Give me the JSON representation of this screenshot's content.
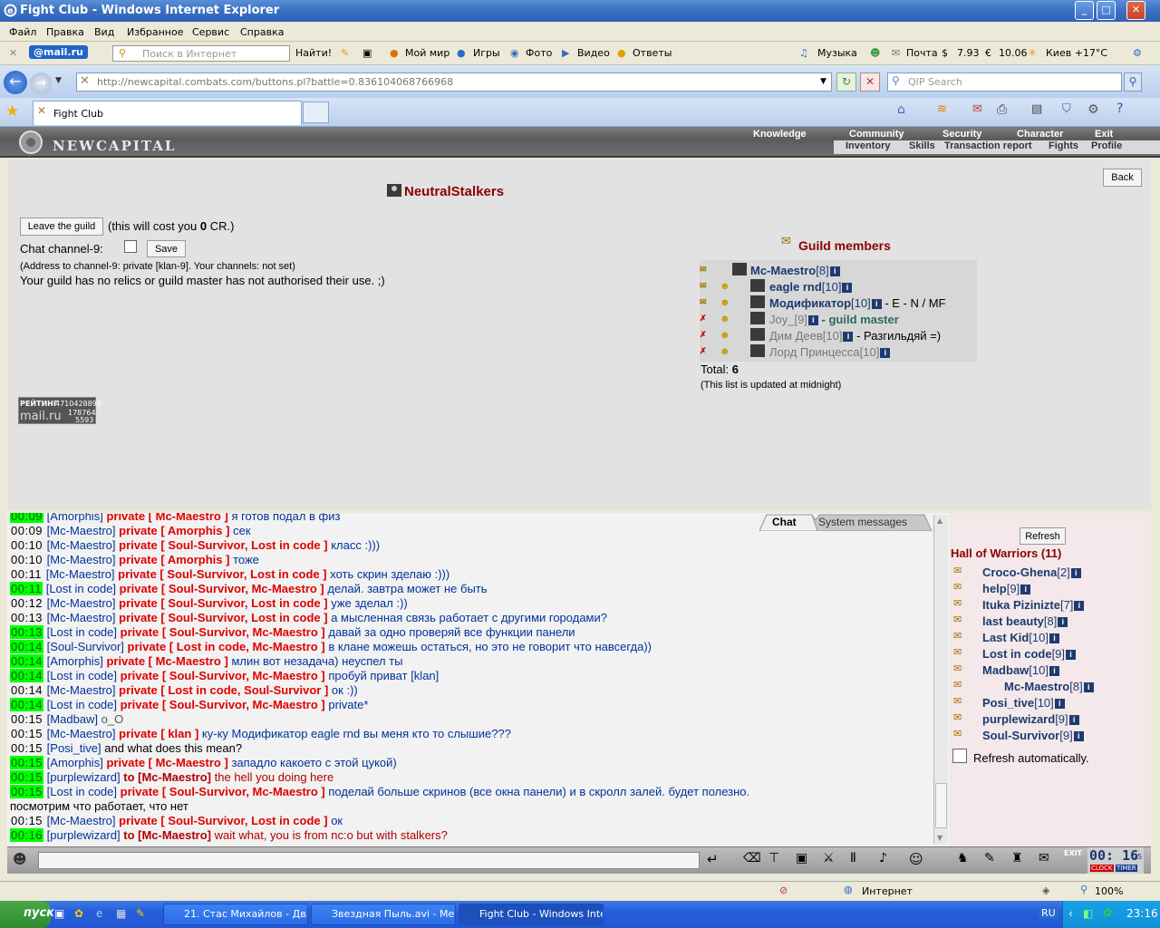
{
  "window": {
    "title": "Fight Club - Windows Internet Explorer"
  },
  "menu": [
    "Файл",
    "Правка",
    "Вид",
    "Избранное",
    "Сервис",
    "Справка"
  ],
  "toolbar": {
    "mailru": "@mail.ru",
    "search_placeholder": "Поиск в Интернет",
    "find": "Найти!",
    "links": [
      "Мой мир",
      "Игры",
      "Фото",
      "Видео",
      "Ответы"
    ],
    "music": "Музыка",
    "mail": "Почта",
    "usd": "7.93",
    "eur": "10.06",
    "weather": "Киев +17°C"
  },
  "address": {
    "url": "http://newcapital.combats.com/buttons.pl?battle=0.836104068766968",
    "qip": "QIP Search"
  },
  "tab": {
    "label": "Fight Club"
  },
  "site": {
    "logo": "NEWCAPITAL",
    "nav": [
      "Knowledge",
      "Community",
      "Security",
      "Character",
      "Exit"
    ],
    "subnav": [
      "Inventory",
      "Skills",
      "Transaction report",
      "Fights",
      "Profile"
    ]
  },
  "guild": {
    "name": "NeutralStalkers",
    "back": "Back",
    "leave": "Leave the guild",
    "cost_pre": "(this will cost you ",
    "cost_num": "0",
    "cost_post": " CR.)",
    "chat_label": "Chat channel-9:",
    "save": "Save",
    "address_note": "(Address to channel-9: private [klan-9]. Your channels: not set)",
    "relics": "Your guild has no relics or guild master has not authorised their use. ;)",
    "members_title": "Guild members",
    "total_label": "Total:",
    "total": "6",
    "update_note": "(This list is updated at midnight)",
    "badge": {
      "label": "РЕЙТИНГ",
      "num": "4710428892",
      "l2": "178764",
      "l3": "5593",
      "brand": "mail.ru"
    },
    "members": [
      {
        "name": "Mc-Maestro",
        "lvl": "[8]",
        "extra": "",
        "grey": false
      },
      {
        "name": "eagle rnd",
        "lvl": "[10]",
        "extra": "",
        "grey": false
      },
      {
        "name": "Модификатор",
        "lvl": "[10]",
        "extra": " - E - N / MF",
        "grey": false
      },
      {
        "name": "Joy_",
        "lvl": "[9]",
        "extra": " - guild master",
        "grey": true
      },
      {
        "name": "Дим Деев",
        "lvl": "[10]",
        "extra": " - Разгильдяй =)",
        "grey": true
      },
      {
        "name": "Лорд Принцесса",
        "lvl": "[10]",
        "extra": "",
        "grey": true
      }
    ]
  },
  "chat": {
    "tab_chat": "Chat",
    "tab_sys": "System messages",
    "lines": [
      {
        "t": "00:09",
        "g": true,
        "s": "Amorphis",
        "p": "private [ Mc-Maestro ]",
        "m": "я готов подал в физ",
        "pc": "pv"
      },
      {
        "t": "00:09",
        "g": false,
        "s": "Mc-Maestro",
        "p": "private [ Amorphis ]",
        "m": "сек",
        "pc": "pv"
      },
      {
        "t": "00:10",
        "g": false,
        "s": "Mc-Maestro",
        "p": "private [ Soul-Survivor, Lost in code ]",
        "m": "класс :)))",
        "pc": "pv"
      },
      {
        "t": "00:10",
        "g": false,
        "s": "Mc-Maestro",
        "p": "private [ Amorphis ]",
        "m": "тоже",
        "pc": "pv"
      },
      {
        "t": "00:11",
        "g": false,
        "s": "Mc-Maestro",
        "p": "private [ Soul-Survivor, Lost in code ]",
        "m": "хоть скрин зделаю :)))",
        "pc": "pv"
      },
      {
        "t": "00:11",
        "g": true,
        "s": "Lost in code",
        "p": "private [ Soul-Survivor, Mc-Maestro ]",
        "m": "делай. завтра может не быть",
        "pc": "pv"
      },
      {
        "t": "00:12",
        "g": false,
        "s": "Mc-Maestro",
        "p": "private [ Soul-Survivor, Lost in code ]",
        "m": "уже зделал :))",
        "pc": "pv"
      },
      {
        "t": "00:13",
        "g": false,
        "s": "Mc-Maestro",
        "p": "private [ Soul-Survivor, Lost in code ]",
        "m": "а мысленная связь работает с другими городами?",
        "pc": "pv"
      },
      {
        "t": "00:13",
        "g": true,
        "s": "Lost in code",
        "p": "private [ Soul-Survivor, Mc-Maestro ]",
        "m": "давай за одно проверяй все функции панели",
        "pc": "pv"
      },
      {
        "t": "00:14",
        "g": true,
        "s": "Soul-Survivor",
        "p": "private [ Lost in code, Mc-Maestro ]",
        "m": "в клане можешь остаться, но это не говорит что навсегда))",
        "pc": "pv"
      },
      {
        "t": "00:14",
        "g": true,
        "s": "Amorphis",
        "p": "private [ Mc-Maestro ]",
        "m": "млин вот незадача) неуспел ты",
        "pc": "pv"
      },
      {
        "t": "00:14",
        "g": true,
        "s": "Lost in code",
        "p": "private [ Soul-Survivor, Mc-Maestro ]",
        "m": "пробуй приват [klan]",
        "pc": "pv"
      },
      {
        "t": "00:14",
        "g": false,
        "s": "Mc-Maestro",
        "p": "private [ Lost in code, Soul-Survivor ]",
        "m": "ок :))",
        "pc": "pv"
      },
      {
        "t": "00:14",
        "g": true,
        "s": "Lost in code",
        "p": "private [ Soul-Survivor, Mc-Maestro ]",
        "m": "private*",
        "pc": "pv"
      },
      {
        "t": "00:15",
        "g": false,
        "s": "Madbaw",
        "p": "",
        "m": "o_O",
        "pc": "pv"
      },
      {
        "t": "00:15",
        "g": false,
        "s": "Mc-Maestro",
        "p": "private [ klan ]",
        "m": "ку-ку Модификатор eagle rnd вы меня кто то слышие???",
        "pc": "pv"
      },
      {
        "t": "00:15",
        "g": false,
        "s": "Posi_tive",
        "p": "",
        "m": "and what does this mean?",
        "pc": "pv"
      },
      {
        "t": "00:15",
        "g": true,
        "s": "Amorphis",
        "p": "private [ Mc-Maestro ]",
        "m": "западло какоето с этой цукой)",
        "pc": "pv"
      },
      {
        "t": "00:15",
        "g": true,
        "s": "purplewizard",
        "p": "to [Mc-Maestro]",
        "m": "the hell you doing here",
        "pc": "to"
      },
      {
        "t": "00:15",
        "g": true,
        "s": "Lost in code",
        "p": "private [ Soul-Survivor, Mc-Maestro ]",
        "m": "поделай больше скринов (все окна панели) и в скролл залей. будет полезно.",
        "pc": "pv"
      },
      {
        "t": "",
        "g": false,
        "s": "",
        "p": "",
        "m": "посмотрим что работает, что нет",
        "pc": "pv"
      },
      {
        "t": "00:15",
        "g": false,
        "s": "Mc-Maestro",
        "p": "private [ Soul-Survivor, Lost in code ]",
        "m": "ок",
        "pc": "pv"
      },
      {
        "t": "00:16",
        "g": true,
        "s": "purplewizard",
        "p": "to [Mc-Maestro]",
        "m": "wait what, you is from nc:o but with stalkers?",
        "pc": "to"
      }
    ]
  },
  "hall": {
    "refresh": "Refresh",
    "title": "Hall of Warriors (11)",
    "auto": "Refresh automatically.",
    "warriors": [
      {
        "n": "Croco-Ghena",
        "l": "[2]"
      },
      {
        "n": "help",
        "l": "[9]"
      },
      {
        "n": "Ituka Pizinizte",
        "l": "[7]"
      },
      {
        "n": "last beauty",
        "l": "[8]"
      },
      {
        "n": "Last Kid",
        "l": "[10]"
      },
      {
        "n": "Lost in code",
        "l": "[9]"
      },
      {
        "n": "Madbaw",
        "l": "[10]"
      },
      {
        "n": "Mc-Maestro",
        "l": "[8]"
      },
      {
        "n": "Posi_tive",
        "l": "[10]"
      },
      {
        "n": "purplewizard",
        "l": "[9]"
      },
      {
        "n": "Soul-Survivor",
        "l": "[9]"
      }
    ]
  },
  "clock": {
    "time": "00: 16",
    "sec": "25",
    "clock": "CLOCK",
    "timer": "TIMER",
    "exit": "EXIT"
  },
  "status": {
    "zone": "Интернет",
    "zoom": "100%"
  },
  "taskbar": {
    "start": "пуск",
    "tasks": [
      "21. Стас Михайлов - Дв...",
      "Звездная Пыль.avi - Ме...",
      "Fight Club - Windows Inte..."
    ],
    "lang": "RU",
    "time": "23:16"
  }
}
